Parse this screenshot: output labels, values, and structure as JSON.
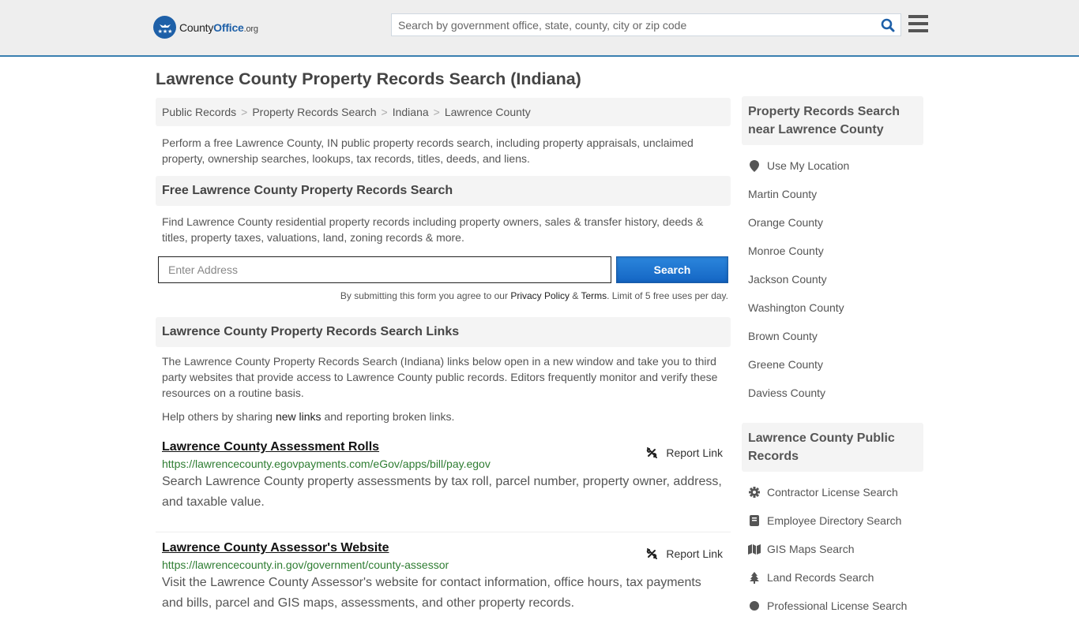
{
  "header": {
    "logo": {
      "part1": "County",
      "part2": "Office",
      "part3": ".org"
    },
    "search_placeholder": "Search by government office, state, county, city or zip code"
  },
  "page_title": "Lawrence County Property Records Search (Indiana)",
  "breadcrumb": [
    "Public Records",
    "Property Records Search",
    "Indiana",
    "Lawrence County"
  ],
  "intro": "Perform a free Lawrence County, IN public property records search, including property appraisals, unclaimed property, ownership searches, lookups, tax records, titles, deeds, and liens.",
  "free_search": {
    "heading": "Free Lawrence County Property Records Search",
    "description": "Find Lawrence County residential property records including property owners, sales & transfer history, deeds & titles, property taxes, valuations, land, zoning records & more.",
    "address_placeholder": "Enter Address",
    "button": "Search",
    "terms_prefix": "By submitting this form you agree to our ",
    "privacy": "Privacy Policy",
    "amp": " & ",
    "terms": "Terms",
    "terms_suffix": ". Limit of 5 free uses per day."
  },
  "links_section": {
    "heading": "Lawrence County Property Records Search Links",
    "description": "The Lawrence County Property Records Search (Indiana) links below open in a new window and take you to third party websites that provide access to Lawrence County public records. Editors frequently monitor and verify these resources on a routine basis.",
    "help_prefix": "Help others by sharing ",
    "help_link": "new links",
    "help_suffix": " and reporting broken links.",
    "report_label": "Report Link",
    "items": [
      {
        "title": "Lawrence County Assessment Rolls",
        "url": "https://lawrencecounty.egovpayments.com/eGov/apps/bill/pay.egov",
        "description": "Search Lawrence County property assessments by tax roll, parcel number, property owner, address, and taxable value."
      },
      {
        "title": "Lawrence County Assessor's Website",
        "url": "https://lawrencecounty.in.gov/government/county-assessor",
        "description": "Visit the Lawrence County Assessor's website for contact information, office hours, tax payments and bills, parcel and GIS maps, assessments, and other property records."
      }
    ]
  },
  "sidebar": {
    "nearby_heading": "Property Records Search near Lawrence County",
    "use_location": "Use My Location",
    "nearby": [
      "Martin County",
      "Orange County",
      "Monroe County",
      "Jackson County",
      "Washington County",
      "Brown County",
      "Greene County",
      "Daviess County"
    ],
    "public_heading": "Lawrence County Public Records",
    "public_records": [
      {
        "label": "Contractor License Search",
        "icon": "gear-icon"
      },
      {
        "label": "Employee Directory Search",
        "icon": "book-icon"
      },
      {
        "label": "GIS Maps Search",
        "icon": "map-icon"
      },
      {
        "label": "Land Records Search",
        "icon": "tree-icon"
      },
      {
        "label": "Professional License Search",
        "icon": "badge-icon"
      }
    ]
  }
}
